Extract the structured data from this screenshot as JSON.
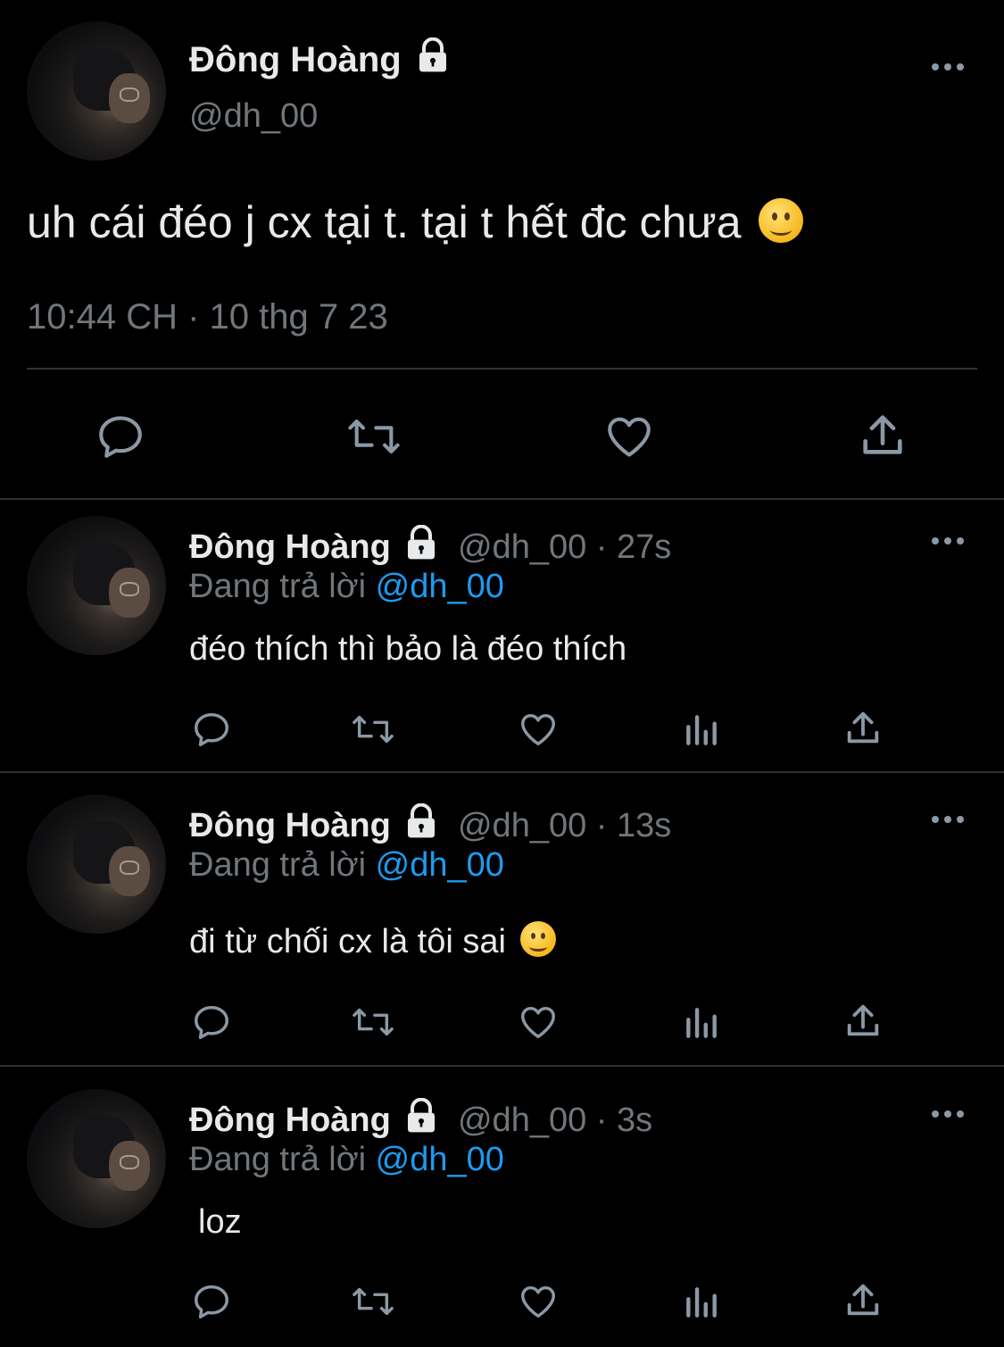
{
  "main_tweet": {
    "display_name": "Đông Hoàng",
    "handle": "@dh_00",
    "text": "uh cái đéo j cx tại t. tại t hết đc chưa",
    "emoji": "slightly-smiling-face",
    "timestamp": "10:44 CH · 10 thg 7 23"
  },
  "replies": [
    {
      "display_name": "Đông Hoàng",
      "meta": "@dh_00 · 27s",
      "replying_prefix": "Đang trả lời",
      "replying_to": "@dh_00",
      "text": "đéo thích thì bảo là đéo thích"
    },
    {
      "display_name": "Đông Hoàng",
      "meta": "@dh_00 · 13s",
      "replying_prefix": "Đang trả lời",
      "replying_to": "@dh_00",
      "text": "đi từ chối cx là tôi sai",
      "emoji": "slightly-smiling-face"
    },
    {
      "display_name": "Đông Hoàng",
      "meta": "@dh_00 · 3s",
      "replying_prefix": "Đang trả lời",
      "replying_to": "@dh_00",
      "text": "loz"
    }
  ],
  "colors": {
    "background": "#000000",
    "text": "#e7e9ea",
    "muted": "#71767b",
    "link": "#1d9bf0",
    "divider": "#2f3336"
  },
  "icons": [
    "lock-icon",
    "more-icon",
    "reply-icon",
    "retweet-icon",
    "like-icon",
    "views-icon",
    "share-icon"
  ]
}
